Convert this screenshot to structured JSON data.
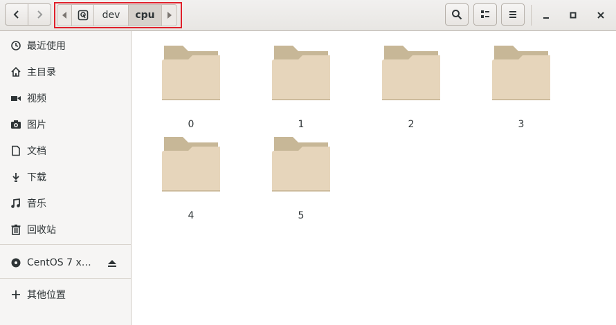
{
  "pathbar": {
    "crumbs": [
      "dev",
      "cpu"
    ]
  },
  "sidebar": {
    "items": [
      {
        "label": "最近使用",
        "icon": "clock-icon"
      },
      {
        "label": "主目录",
        "icon": "home-icon"
      },
      {
        "label": "视频",
        "icon": "video-icon"
      },
      {
        "label": "图片",
        "icon": "camera-icon"
      },
      {
        "label": "文档",
        "icon": "document-icon"
      },
      {
        "label": "下载",
        "icon": "download-icon"
      },
      {
        "label": "音乐",
        "icon": "music-icon"
      },
      {
        "label": "回收站",
        "icon": "trash-icon"
      }
    ],
    "devices": [
      {
        "label": "CentOS 7 x…",
        "icon": "disc-icon"
      }
    ],
    "other": {
      "label": "其他位置",
      "icon": "plus-icon"
    }
  },
  "files": [
    "0",
    "1",
    "2",
    "3",
    "4",
    "5"
  ],
  "colors": {
    "accent_highlight": "#e0202a",
    "folder": "#e6d5bb",
    "folder_tab": "#c7b797"
  }
}
